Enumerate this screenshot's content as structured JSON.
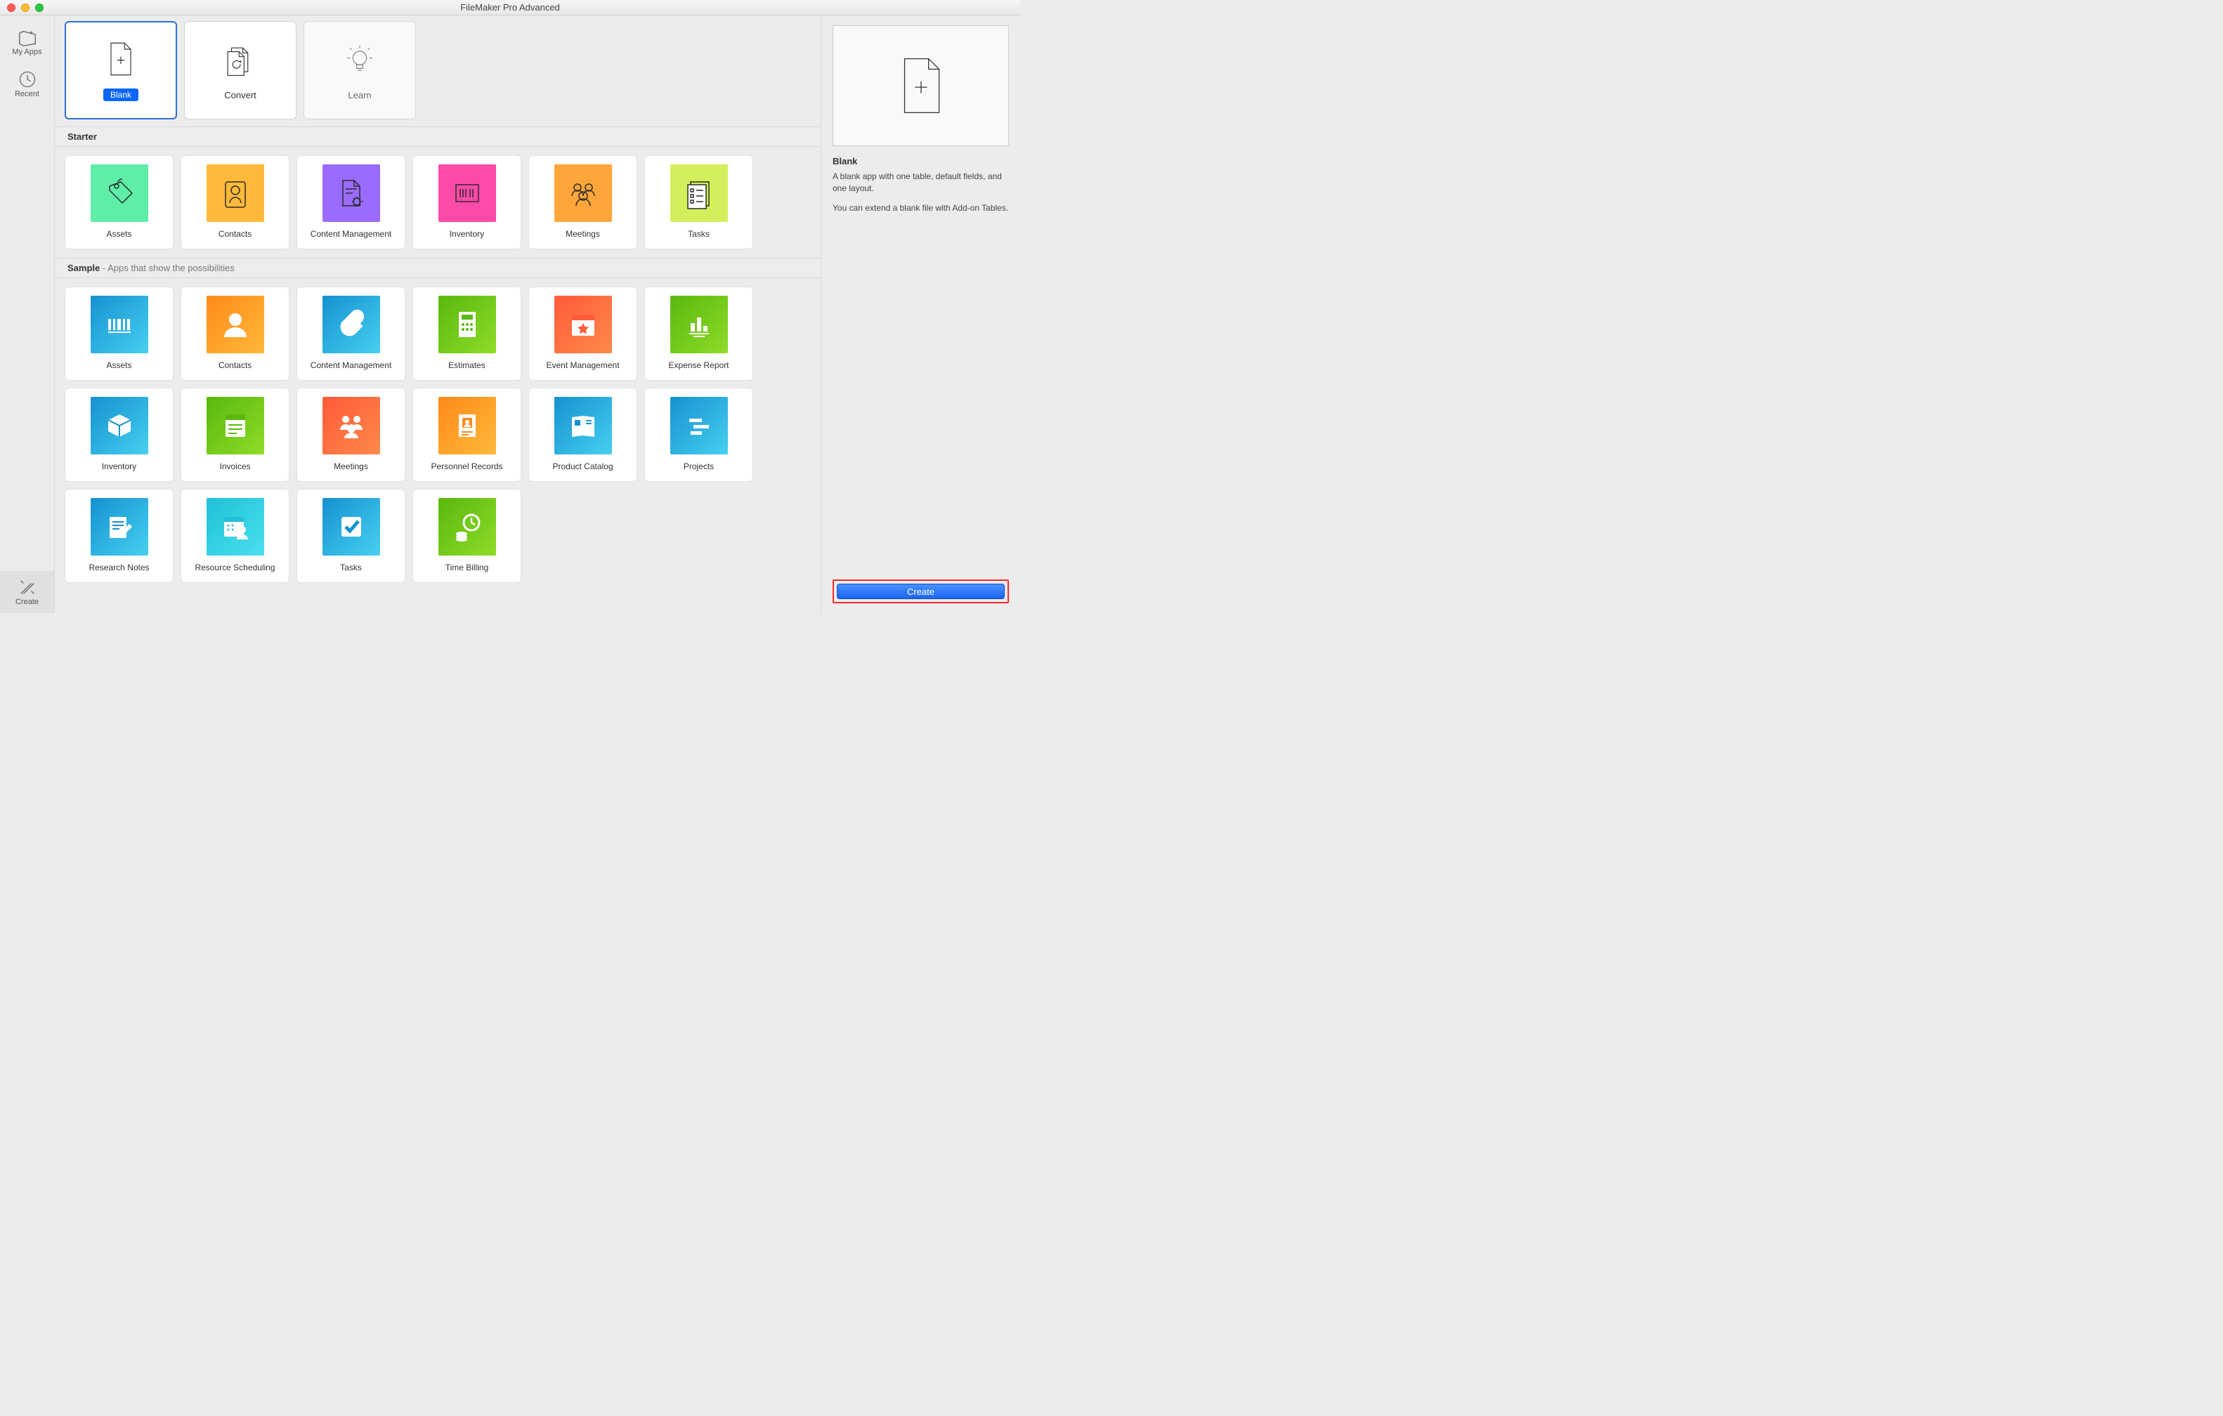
{
  "window": {
    "title": "FileMaker Pro Advanced"
  },
  "sidebar": {
    "myapps": "My Apps",
    "recent": "Recent",
    "create": "Create"
  },
  "tabs": {
    "blank": "Blank",
    "convert": "Convert",
    "learn": "Learn"
  },
  "sections": {
    "starter": "Starter",
    "sample_title": "Sample",
    "sample_sub": " - Apps that show the possibilities"
  },
  "starter": {
    "assets": "Assets",
    "contacts": "Contacts",
    "content_mgmt": "Content Management",
    "inventory": "Inventory",
    "meetings": "Meetings",
    "tasks": "Tasks"
  },
  "sample": {
    "assets": "Assets",
    "contacts": "Contacts",
    "content_mgmt": "Content Management",
    "estimates": "Estimates",
    "event_mgmt": "Event Management",
    "expense": "Expense Report",
    "inventory": "Inventory",
    "invoices": "Invoices",
    "meetings": "Meetings",
    "personnel": "Personnel Records",
    "catalog": "Product Catalog",
    "projects": "Projects",
    "research": "Research Notes",
    "resource": "Resource Scheduling",
    "tasks": "Tasks",
    "billing": "Time Billing"
  },
  "info": {
    "title": "Blank",
    "desc1": "A blank app with one table, default fields, and one layout.",
    "desc2": "You can extend a blank file with Add-on Tables.",
    "create_btn": "Create"
  },
  "colors": {
    "starter_assets": "#5eeea8",
    "starter_contacts": "#ffb93a",
    "starter_content": "#9a6bff",
    "starter_inventory": "#ff4aa8",
    "starter_meetings": "#ffa63a",
    "starter_tasks": "#d3ef5b",
    "sample_assets_a": "#1691d0",
    "sample_assets_b": "#46d0f0",
    "sample_contacts_a": "#ff8a1a",
    "sample_contacts_b": "#ffb93a",
    "sample_content_a": "#1691d0",
    "sample_content_b": "#46d0f0",
    "sample_estimates_a": "#5ab80e",
    "sample_estimates_b": "#8fdc28",
    "sample_event_a": "#ff5a3a",
    "sample_event_b": "#ff8a4a",
    "sample_expense_a": "#5ab80e",
    "sample_expense_b": "#8fdc28",
    "sample_inventory_a": "#1691d0",
    "sample_inventory_b": "#46d0f0",
    "sample_invoices_a": "#5ab80e",
    "sample_invoices_b": "#8fdc28",
    "sample_meetings_a": "#ff5a3a",
    "sample_meetings_b": "#ff8a4a",
    "sample_personnel_a": "#ff8a1a",
    "sample_personnel_b": "#ffb93a",
    "sample_catalog_a": "#1691d0",
    "sample_catalog_b": "#46d0f0",
    "sample_projects_a": "#1691d0",
    "sample_projects_b": "#46d0f0",
    "sample_research_a": "#1691d0",
    "sample_research_b": "#46d0f0",
    "sample_resource_a": "#20c0d8",
    "sample_resource_b": "#4ae0ee",
    "sample_tasks_a": "#1691d0",
    "sample_tasks_b": "#46d0f0",
    "sample_billing_a": "#5ab80e",
    "sample_billing_b": "#8fdc28"
  }
}
